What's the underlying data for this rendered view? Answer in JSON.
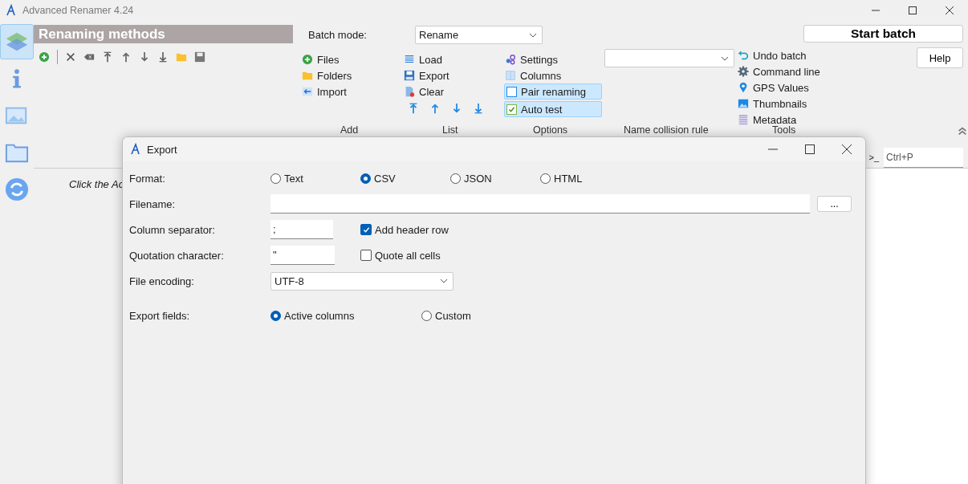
{
  "window": {
    "title": "Advanced Renamer 4.24"
  },
  "sidebar": {
    "items": [
      {
        "selected": true
      },
      {
        "selected": false
      },
      {
        "selected": false
      },
      {
        "selected": false
      },
      {
        "selected": false
      }
    ]
  },
  "methods_panel": {
    "title": "Renaming methods",
    "hint": "Click the Ac"
  },
  "batch_mode": {
    "label": "Batch mode:",
    "value": "Rename"
  },
  "add_group": {
    "label": "Add",
    "items": [
      "Files",
      "Folders",
      "Import"
    ]
  },
  "list_group": {
    "label": "List",
    "items": [
      "Load",
      "Export",
      "Clear"
    ]
  },
  "options_group": {
    "label": "Options",
    "items": [
      {
        "label": "Settings",
        "kind": "button"
      },
      {
        "label": "Columns",
        "kind": "button"
      },
      {
        "label": "Pair renaming",
        "kind": "toggle",
        "checked": false
      },
      {
        "label": "Auto test",
        "kind": "toggle",
        "checked": true
      }
    ]
  },
  "collision_group": {
    "label": "Name collision rule"
  },
  "tools_group": {
    "label": "Tools",
    "items": [
      "Undo batch",
      "Command line",
      "GPS Values",
      "Thumbnails",
      "Metadata"
    ]
  },
  "start_button": "Start batch",
  "help_button": "Help",
  "command_field": {
    "prompt": ">_",
    "placeholder": "Ctrl+P"
  },
  "dialog": {
    "title": "Export",
    "format": {
      "label": "Format:",
      "options": [
        {
          "label": "Text",
          "selected": false
        },
        {
          "label": "CSV",
          "selected": true
        },
        {
          "label": "JSON",
          "selected": false
        },
        {
          "label": "HTML",
          "selected": false
        }
      ]
    },
    "filename": {
      "label": "Filename:",
      "button": "..."
    },
    "column_separator": {
      "label": "Column separator:",
      "value": ";"
    },
    "add_header_row": {
      "label": "Add header row",
      "checked": true
    },
    "quotation": {
      "label": "Quotation character:",
      "value": "\""
    },
    "quote_all": {
      "label": "Quote all cells",
      "checked": false
    },
    "encoding": {
      "label": "File encoding:",
      "value": "UTF-8"
    },
    "export_fields": {
      "label": "Export fields:",
      "options": [
        {
          "label": "Active columns",
          "selected": true
        },
        {
          "label": "Custom",
          "selected": false
        }
      ]
    }
  }
}
